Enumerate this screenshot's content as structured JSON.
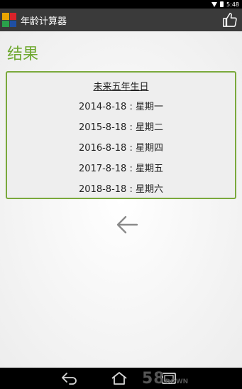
{
  "status_bar": {
    "time": "5:48",
    "icons": [
      "wifi-icon",
      "battery-icon"
    ]
  },
  "action_bar": {
    "title": "年龄计算器",
    "app_icon": "app-logo-icon",
    "app_icon_colors": [
      "#e8a400",
      "#d9232a",
      "#2aa14b",
      "#1f4fa3"
    ],
    "like_icon": "thumbs-up-icon"
  },
  "main": {
    "heading": "结果",
    "result_box": {
      "title": "未来五年生日",
      "rows": [
        "2014-8-18 : 星期一",
        "2015-8-18 : 星期二",
        "2016-8-18 : 星期四",
        "2017-8-18 : 星期五",
        "2018-8-18 : 星期六"
      ]
    },
    "back_icon": "back-arrow-icon"
  },
  "nav_bar": {
    "icons": [
      "back-icon",
      "home-icon",
      "recents-icon"
    ],
    "watermark_text": "58",
    "watermark_sub": "DOWN"
  },
  "colors": {
    "accent": "#6ea82f",
    "box_border": "#7aa93c",
    "action_bar": "#3a3a3a"
  }
}
